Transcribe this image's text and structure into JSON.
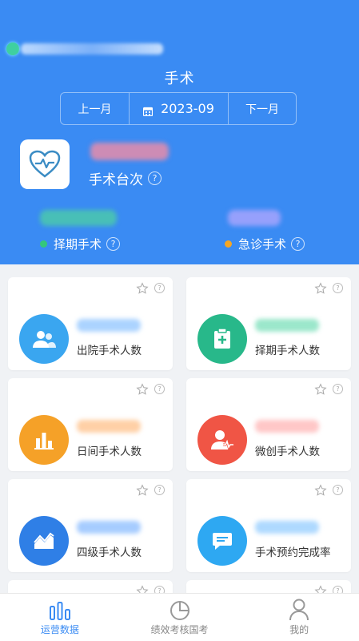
{
  "header": {
    "title": "手术",
    "prev_month": "上一月",
    "current_month": "2023-09",
    "next_month": "下一月",
    "total_label": "手术台次",
    "elective_label": "择期手术",
    "emergency_label": "急诊手术",
    "help_glyph": "?"
  },
  "cards": [
    {
      "label": "出院手术人数",
      "icon": "users-icon",
      "color": "#3aa6f0"
    },
    {
      "label": "择期手术人数",
      "icon": "clipboard-plus-icon",
      "color": "#28b88a"
    },
    {
      "label": "日间手术人数",
      "icon": "bar-chart-icon",
      "color": "#f5a128"
    },
    {
      "label": "微创手术人数",
      "icon": "user-pulse-icon",
      "color": "#f05545"
    },
    {
      "label": "四级手术人数",
      "icon": "line-trend-icon",
      "color": "#2f7fe6"
    },
    {
      "label": "手术预约完成率",
      "icon": "chat-icon",
      "color": "#2ea8f2"
    }
  ],
  "tabs": [
    {
      "label": "运营数据",
      "active": true
    },
    {
      "label": "绩效考核国考",
      "active": false
    },
    {
      "label": "我的",
      "active": false
    }
  ],
  "colors": {
    "primary": "#3a8bf3",
    "elective_dot": "#34c77b",
    "emergency_dot": "#f5a623"
  }
}
